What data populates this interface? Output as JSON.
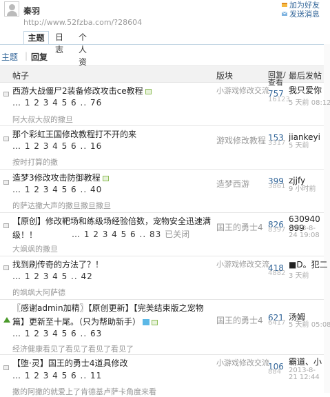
{
  "header": {
    "username": "秦羽",
    "url": "http://www.52fzba.com/?28604",
    "actions": [
      "加为好友",
      "发送消息"
    ],
    "tabs": [
      "主题",
      "日志",
      "个人资料"
    ]
  },
  "subnav": {
    "topics": "主题",
    "replies": "回复"
  },
  "columns": {
    "post": "帖子",
    "forum": "版块",
    "replies_views": "回复/查看",
    "last": "最后发帖"
  },
  "threads": [
    {
      "title": "西游大战僵尸2装备修改攻击ce教程",
      "pages": "… 1 2 3 4 5 6 .. 76",
      "closed": "",
      "preview": "阿大叔大叔的撒旦",
      "forum": "小游戏修改交流",
      "replies": "757",
      "views": "16123",
      "last_user": "我只爱你",
      "last_time": "5 天前 08:12"
    },
    {
      "title": "那个彩虹王国修改教程打不开的来",
      "pages": "… 1 2 3 4 5 6 .. 16",
      "closed": "",
      "preview": "按时打算的撒",
      "forum": "游戏修改教程",
      "replies": "153",
      "views": "3317",
      "last_user": "jiankeyi",
      "last_time": "5 天前"
    },
    {
      "title": "造梦3修改攻击防御教程",
      "pages": "… 1 2 3 4 5 6 .. 40",
      "closed": "",
      "preview": "的萨达撒大声的撒旦撒旦撒旦",
      "forum": "造梦西游",
      "replies": "399",
      "views": "3861",
      "last_user": "zjjfy",
      "last_time": "9 小时前"
    },
    {
      "title": "【原创】修改靶场和练级场经验倍数，宠物安全迅速满级！！",
      "pages": "… 1 2 3 4 5 6 .. 83",
      "closed": "已关闭",
      "preview": "大飒飒的撒旦",
      "forum": "国王的勇士4",
      "replies": "826",
      "views": "8397",
      "last_user": "630940899",
      "last_time": "2013-8-24 19:08"
    },
    {
      "title": "找到刷传奇的方法了？！",
      "pages": "… 1 2 3 4 5 .. 42",
      "closed": "",
      "preview": "的飒飒大阿萨德",
      "forum": "小游戏修改交流",
      "replies": "418",
      "views": "4882",
      "last_user": "■D。犯二少年",
      "last_time": "3 天前"
    },
    {
      "title": "〖感谢admin加精〗【原创更新】【完美结束版之宠物篇】更新至十尾。（只为帮助新手）",
      "pages": "… 1 2 3 4 5 6 .. 63",
      "closed": "",
      "preview": "经济健康看见了看见了看见了看见了",
      "forum": "国王的勇士4",
      "replies": "621",
      "views": "6417",
      "last_user": "汤姆",
      "last_time": "5 天前 05:08"
    },
    {
      "title": "【堕·灵】国王的勇士4道具修改",
      "pages": "… 1 2 3 4 5 6 .. 11",
      "closed": "",
      "preview": "撒的阿撒的就爱上了肯德基卢萨卡角度来看",
      "forum": "小游戏修改交流",
      "replies": "106",
      "views": "884",
      "last_user": "霸道、小",
      "last_time": "2013-8-21 12:44"
    }
  ]
}
